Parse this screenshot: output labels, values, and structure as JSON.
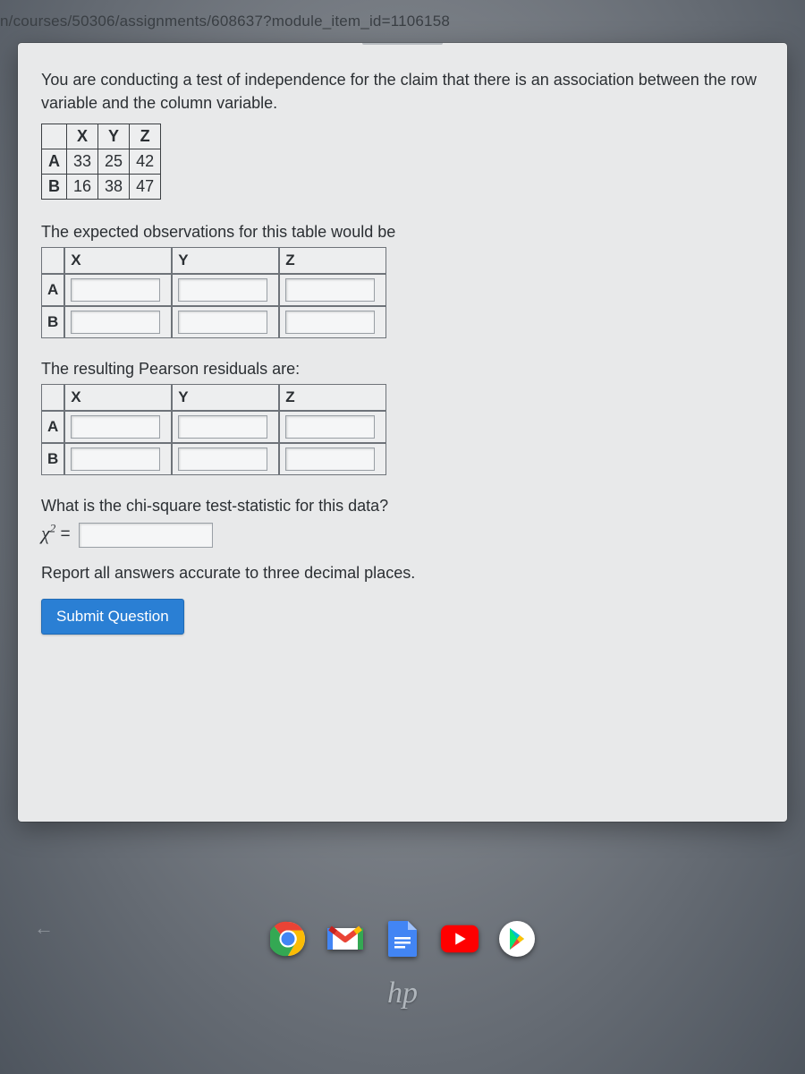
{
  "url": "n/courses/50306/assignments/608637?module_item_id=1106158",
  "intro": "You are conducting a test of independence for the claim that there is an association between the row variable and the column variable.",
  "observed": {
    "columns": [
      "X",
      "Y",
      "Z"
    ],
    "rows": [
      {
        "label": "A",
        "values": [
          "33",
          "25",
          "42"
        ]
      },
      {
        "label": "B",
        "values": [
          "16",
          "38",
          "47"
        ]
      }
    ]
  },
  "expected_label": "The expected observations for this table would be",
  "expected": {
    "columns": [
      "X",
      "Y",
      "Z"
    ],
    "rows": [
      "A",
      "B"
    ]
  },
  "residuals_label": "The resulting Pearson residuals are:",
  "residuals": {
    "columns": [
      "X",
      "Y",
      "Z"
    ],
    "rows": [
      "A",
      "B"
    ]
  },
  "chi_question": "What is the chi-square test-statistic for this data?",
  "chi_symbol": "χ",
  "chi_equals": " = ",
  "note": "Report all answers accurate to three decimal places.",
  "submit": "Submit Question",
  "hp": "hp"
}
